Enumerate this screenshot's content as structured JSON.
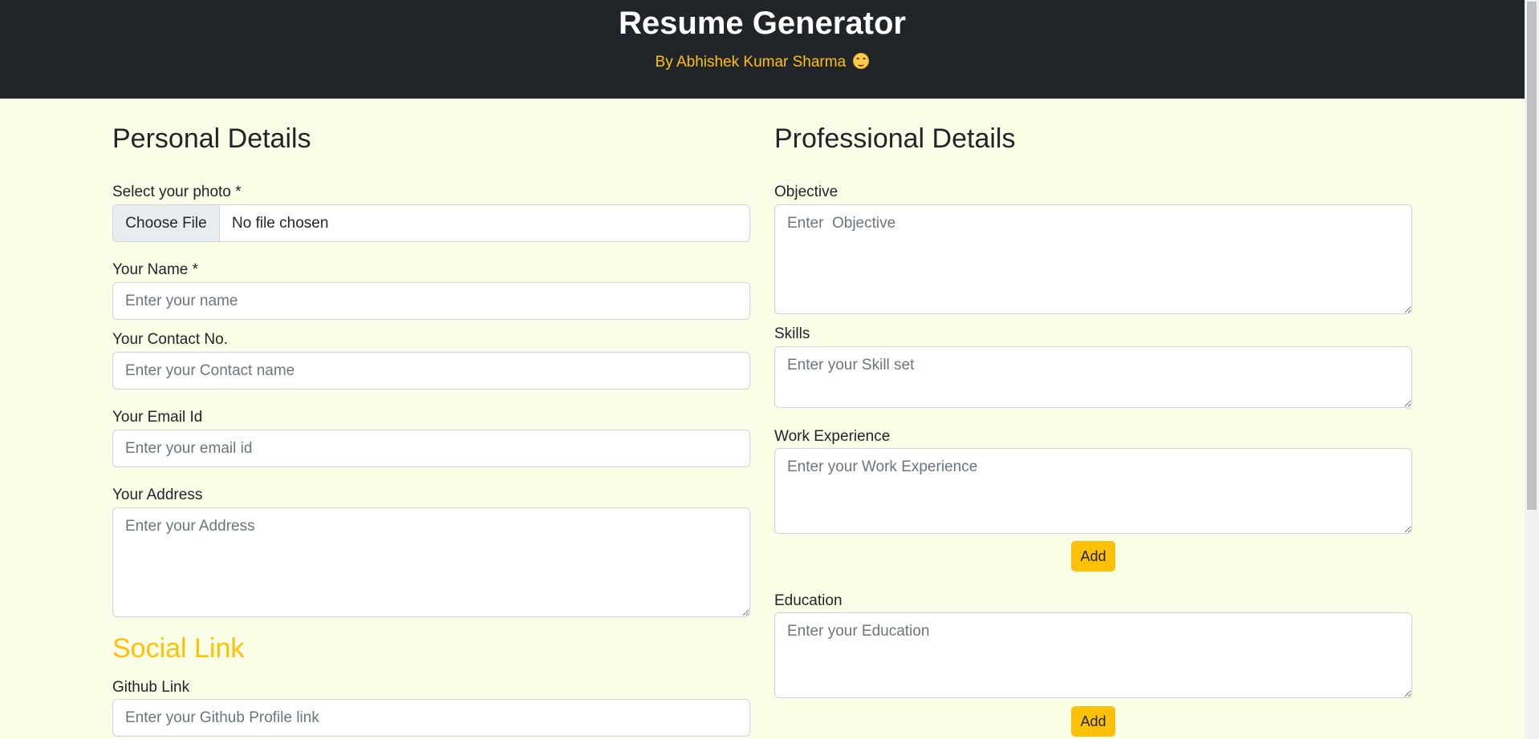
{
  "header": {
    "title": "Resume Generator",
    "byline": "By Abhishek Kumar Sharma"
  },
  "personal": {
    "heading": "Personal Details",
    "photo_label": "Select your photo *",
    "file_button": "Choose File",
    "file_status": "No file chosen",
    "name_label": "Your Name *",
    "name_placeholder": "Enter your name",
    "contact_label": "Your Contact No.",
    "contact_placeholder": "Enter your Contact name",
    "email_label": "Your Email Id",
    "email_placeholder": "Enter your email id",
    "address_label": "Your Address",
    "address_placeholder": "Enter your Address"
  },
  "social": {
    "heading": "Social Link",
    "github_label": "Github Link",
    "github_placeholder": "Enter your Github Profile link"
  },
  "professional": {
    "heading": "Professional Details",
    "objective_label": "Objective",
    "objective_placeholder": "Enter  Objective",
    "skills_label": "Skills",
    "skills_placeholder": "Enter your Skill set",
    "work_label": "Work Experience",
    "work_placeholder": "Enter your Work Experience",
    "work_add": "Add",
    "education_label": "Education",
    "education_placeholder": "Enter your Education",
    "education_add": "Add"
  },
  "colors": {
    "header_bg": "#212529",
    "accent": "#ffc107",
    "page_bg": "#fafee6"
  }
}
